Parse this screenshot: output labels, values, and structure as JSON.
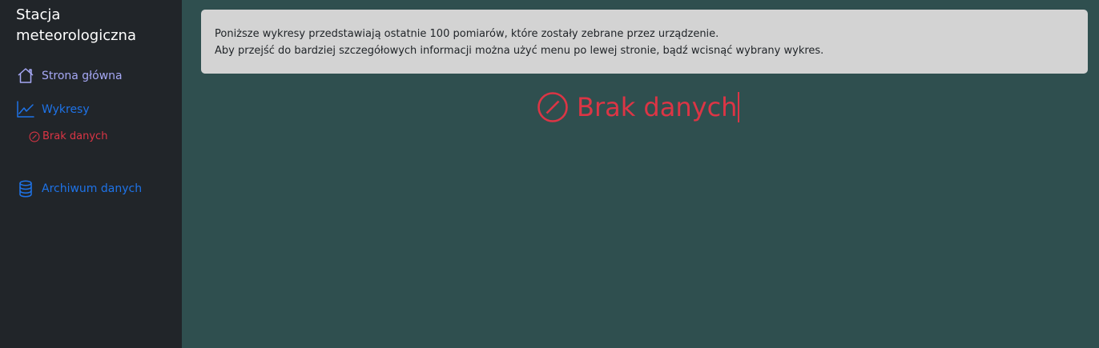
{
  "sidebar": {
    "brand_line1": "Stacja",
    "brand_line2": "meteorologiczna",
    "home_label": "Strona główna",
    "charts_label": "Wykresy",
    "charts_sub_label": "Brak danych",
    "archive_label": "Archiwum danych"
  },
  "main": {
    "info_line1": "Poniższe wykresy przedstawiają ostatnie 100 pomiarów, które zostały zebrane przez urządzenie.",
    "info_line2": "Aby przejść do bardziej szczegółowych informacji można użyć menu po lewej stronie, bądź wcisnąć wybrany wykres.",
    "no_data_label": "Brak danych"
  },
  "colors": {
    "sidebar_bg": "#212529",
    "main_bg": "#2f4f4f",
    "link_blue": "#1e73e8",
    "link_home": "#a6a8f5",
    "danger": "#dc3545",
    "alert_bg": "#d3d3d3"
  },
  "icons": {
    "home": "house-icon",
    "charts": "graph-up-icon",
    "no_data": "slash-circle-icon",
    "archive": "database-icon"
  }
}
